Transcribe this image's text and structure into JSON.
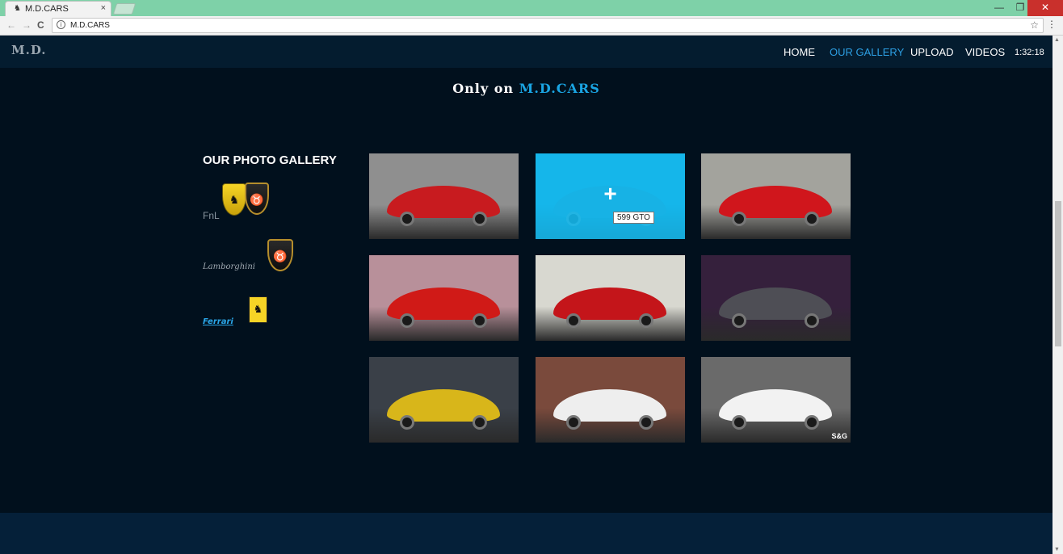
{
  "browser": {
    "tab_title": "M.D.CARS",
    "tab_close": "×",
    "url": "M.D.CARS",
    "back": "←",
    "forward": "→",
    "reload": "C",
    "info_icon": "i",
    "star": "☆",
    "menu": "⋮",
    "win_min": "—",
    "win_max": "❐",
    "win_close": "✕"
  },
  "site": {
    "logo": "M.D.",
    "nav": [
      {
        "label": "HOME"
      },
      {
        "label": "OUR GALLERY"
      },
      {
        "label": "UPLOAD"
      },
      {
        "label": "VIDEOS"
      }
    ],
    "active_nav": "OUR GALLERY",
    "clock": "1:32:18",
    "accent_color": "#2d9fe3"
  },
  "tagline": {
    "prefix": "Only on ",
    "brand": "M.D.CARS"
  },
  "gallery": {
    "title": "OUR PHOTO GALLERY",
    "brands": [
      {
        "label": "FnL",
        "icon": "ferrari-lamborghini-shields"
      },
      {
        "label": "Lamborghini",
        "icon": "lamborghini-shield"
      },
      {
        "label": "Ferrari",
        "icon": "ferrari-badge"
      }
    ],
    "photos": [
      {
        "icon": "red-ferrari-458-speciale-photo",
        "bg": "#8f8f8f",
        "car": "#c81b1f"
      },
      {
        "icon": "599-gto-photo",
        "bg": "#1d84a8",
        "car": "#2a6a85",
        "hover": true,
        "plus": "+",
        "caption": "599 GTO"
      },
      {
        "icon": "red-ferrari-enzo-photo",
        "bg": "#a3a39d",
        "car": "#d0161c"
      },
      {
        "icon": "red-ferrari-348-photo",
        "bg": "#b8909a",
        "car": "#d01a17"
      },
      {
        "icon": "red-ferrari-f355-photo",
        "bg": "#d8d8d0",
        "car": "#c4151a"
      },
      {
        "icon": "grey-ferrari-f12-photo",
        "bg": "#35203c",
        "car": "#4e4e55"
      },
      {
        "icon": "yellow-ferrari-f430-photo",
        "bg": "#3a4048",
        "car": "#d8b61a"
      },
      {
        "icon": "white-laferrari-photo",
        "bg": "#7a4a3c",
        "car": "#eeeeee"
      },
      {
        "icon": "white-ferrari-f12-tdf-photo",
        "bg": "#6a6a6a",
        "car": "#f2f2f2",
        "watermark": "S&G"
      }
    ]
  }
}
